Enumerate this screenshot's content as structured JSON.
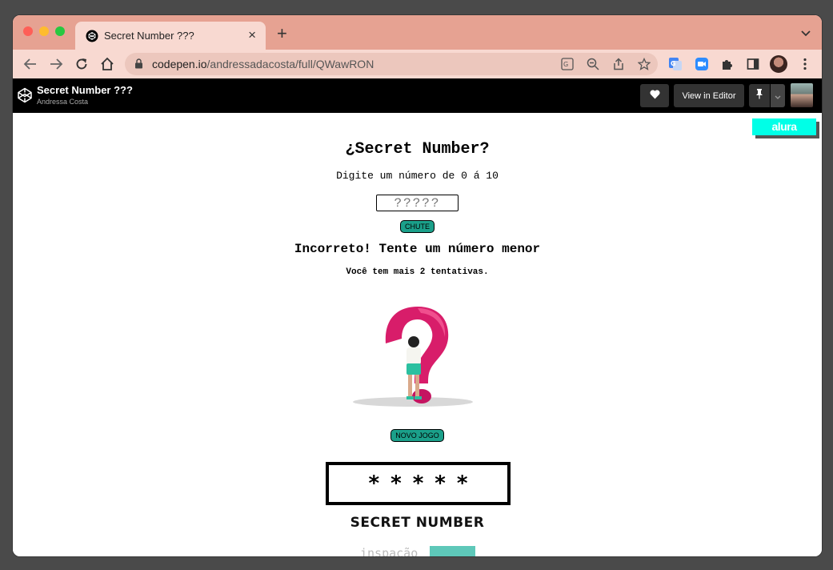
{
  "browser": {
    "tab_title": "Secret Number ???",
    "tab_close": "×",
    "new_tab": "+",
    "url_host": "codepen.io",
    "url_path": "/andressadacosta/full/QWawRON"
  },
  "codepen": {
    "pen_title": "Secret Number ???",
    "author": "Andressa Costa",
    "view_in_editor": "View in Editor"
  },
  "page": {
    "badge": "alura",
    "heading": "¿Secret Number?",
    "instruction": "Digite um número de 0 á 10",
    "input_placeholder": "?????",
    "guess_button": "CHUTE",
    "result_message": "Incorreto! Tente um número menor",
    "attempts_message": "Você tem mais 2 tentativas.",
    "new_game_button": "NOVO JOGO",
    "logo_stars": "*****",
    "logo_text": "SECRET NUMBER",
    "bottom_partial_text": "inspação"
  },
  "colors": {
    "tabstrip": "#e6a292",
    "toolbar": "#f8d9d1",
    "teal_button": "#1ba08a",
    "alura_badge": "#00ffe7"
  }
}
